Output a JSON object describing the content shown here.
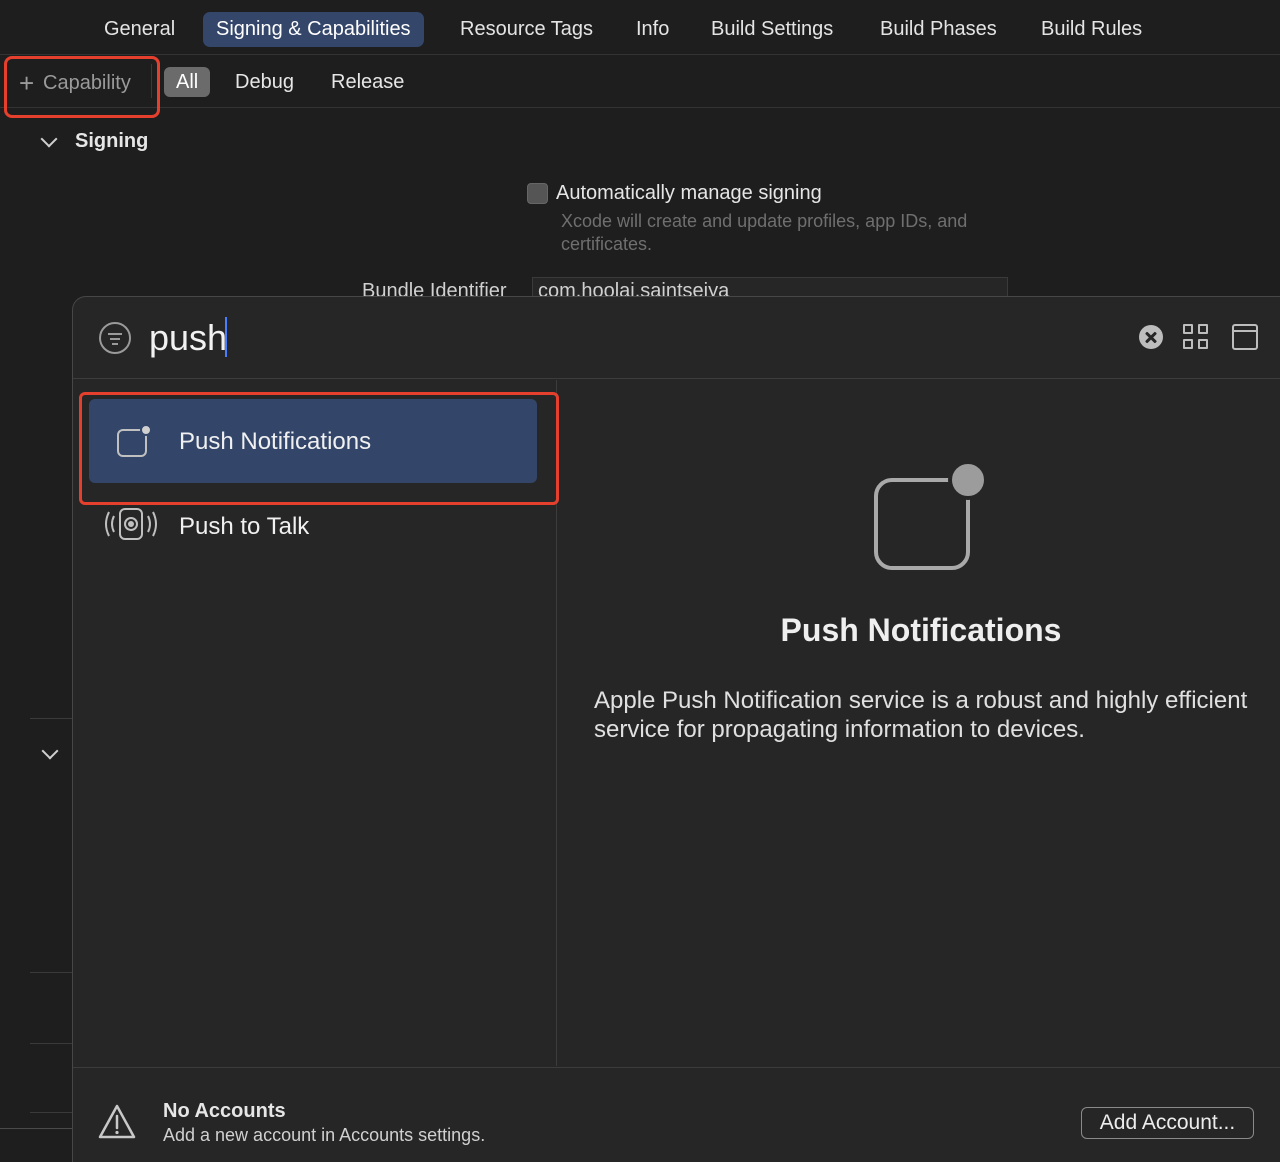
{
  "tabs": [
    {
      "label": "General",
      "active": false
    },
    {
      "label": "Signing & Capabilities",
      "active": true
    },
    {
      "label": "Resource Tags",
      "active": false
    },
    {
      "label": "Info",
      "active": false
    },
    {
      "label": "Build Settings",
      "active": false
    },
    {
      "label": "Build Phases",
      "active": false
    },
    {
      "label": "Build Rules",
      "active": false
    }
  ],
  "subbar": {
    "capability_label": "Capability",
    "segments": [
      "All",
      "Debug",
      "Release"
    ],
    "selected_segment": "All"
  },
  "signing": {
    "section_title": "Signing",
    "auto_manage_label": "Automatically manage signing",
    "auto_manage_checked": false,
    "auto_manage_desc": "Xcode will create and update profiles, app IDs, and certificates.",
    "bundle_identifier_label": "Bundle Identifier",
    "bundle_identifier_value": "com.hoolai.saintseiya"
  },
  "popover": {
    "search_value": "push",
    "results": [
      {
        "name": "Push Notifications",
        "icon": "push-notifications-icon",
        "selected": true
      },
      {
        "name": "Push to Talk",
        "icon": "push-to-talk-icon",
        "selected": false
      }
    ],
    "detail": {
      "title": "Push Notifications",
      "description": "Apple Push Notification service is a robust and highly efficient service for propagating information to devices."
    },
    "footer": {
      "title": "No Accounts",
      "description": "Add a new account in Accounts settings.",
      "button_label": "Add Account..."
    }
  },
  "colors": {
    "accent": "#34466a",
    "highlight_frame": "#e5402d",
    "background": "#1e1e1e",
    "popover_background": "#262626"
  }
}
